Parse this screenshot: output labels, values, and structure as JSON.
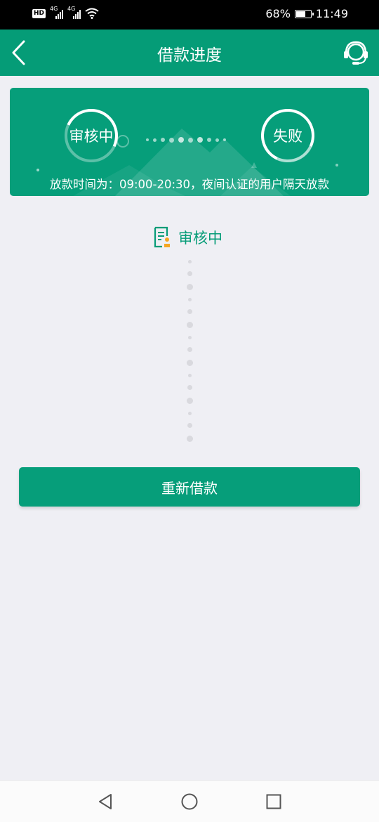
{
  "status_bar": {
    "hd": "HD",
    "network1": "4G",
    "network2": "4G",
    "battery_percent": "68%",
    "battery_level": 0.68,
    "time": "11:49",
    "icons": [
      "signal-icon",
      "wifi-icon",
      "battery-icon"
    ]
  },
  "header": {
    "title": "借款进度",
    "back_icon": "chevron-left-icon",
    "support_icon": "headset-icon"
  },
  "progress_card": {
    "step1": "审核中",
    "step2": "失败",
    "notice": "放款时间为：09:00-20:30，夜间认证的用户隔天放款"
  },
  "current_status": {
    "icon": "document-review-icon",
    "label": "审核中"
  },
  "actions": {
    "reapply": "重新借款"
  },
  "colors": {
    "brand": "#059c77",
    "background": "#efeff4",
    "stamp": "#f5a623"
  },
  "system_nav": [
    "back-triangle-icon",
    "home-circle-icon",
    "recents-square-icon"
  ]
}
